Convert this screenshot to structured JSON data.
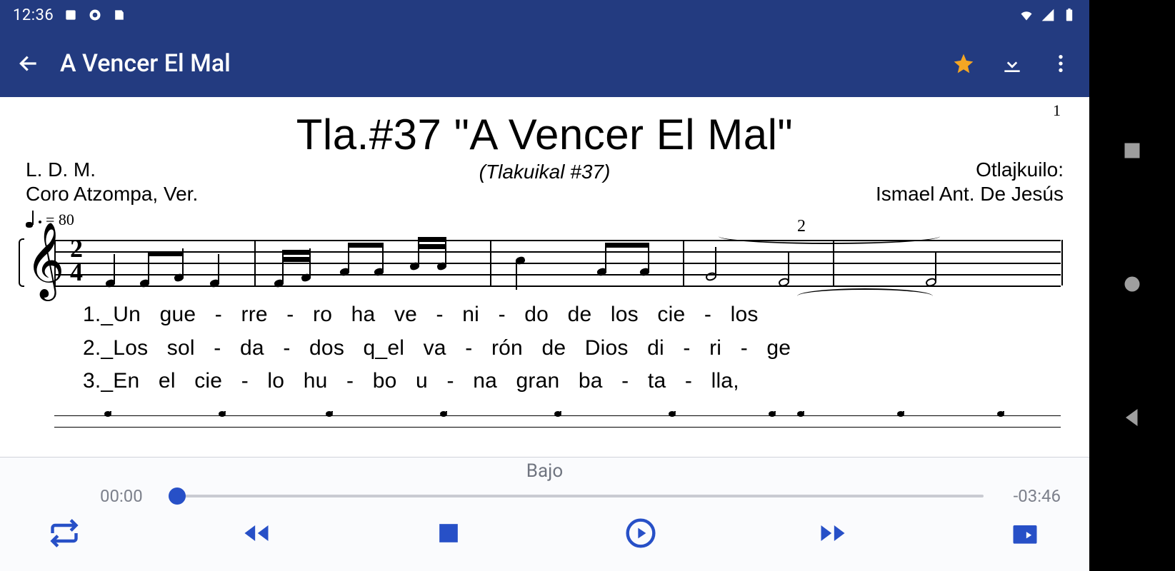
{
  "statusbar": {
    "time": "12:36"
  },
  "appbar": {
    "title": "A Vencer El Mal"
  },
  "score": {
    "page_number": "1",
    "title": "Tla.#37 \"A Vencer El Mal\"",
    "subtitle": "(Tlakuikal #37)",
    "left_line1": "L. D. M.",
    "left_line2": "Coro Atzompa, Ver.",
    "right_line1": "Otlajkuilo:",
    "right_line2": "Ismael Ant. De Jesús",
    "tempo_value": "= 80",
    "time_sig_top": "2",
    "time_sig_bottom": "4",
    "phrase_mark": "2"
  },
  "lyrics": {
    "line1": "1._Un gue - rre - ro ha ve - ni - do de los cie - los",
    "line2": "2._Los sol - da - dos q_el va - rón de Dios di - ri - ge",
    "line3": "3._En el cie - lo hu - bo u - na gran ba - ta - lla,"
  },
  "player": {
    "track_label": "Bajo",
    "elapsed": "00:00",
    "remaining": "-03:46"
  }
}
